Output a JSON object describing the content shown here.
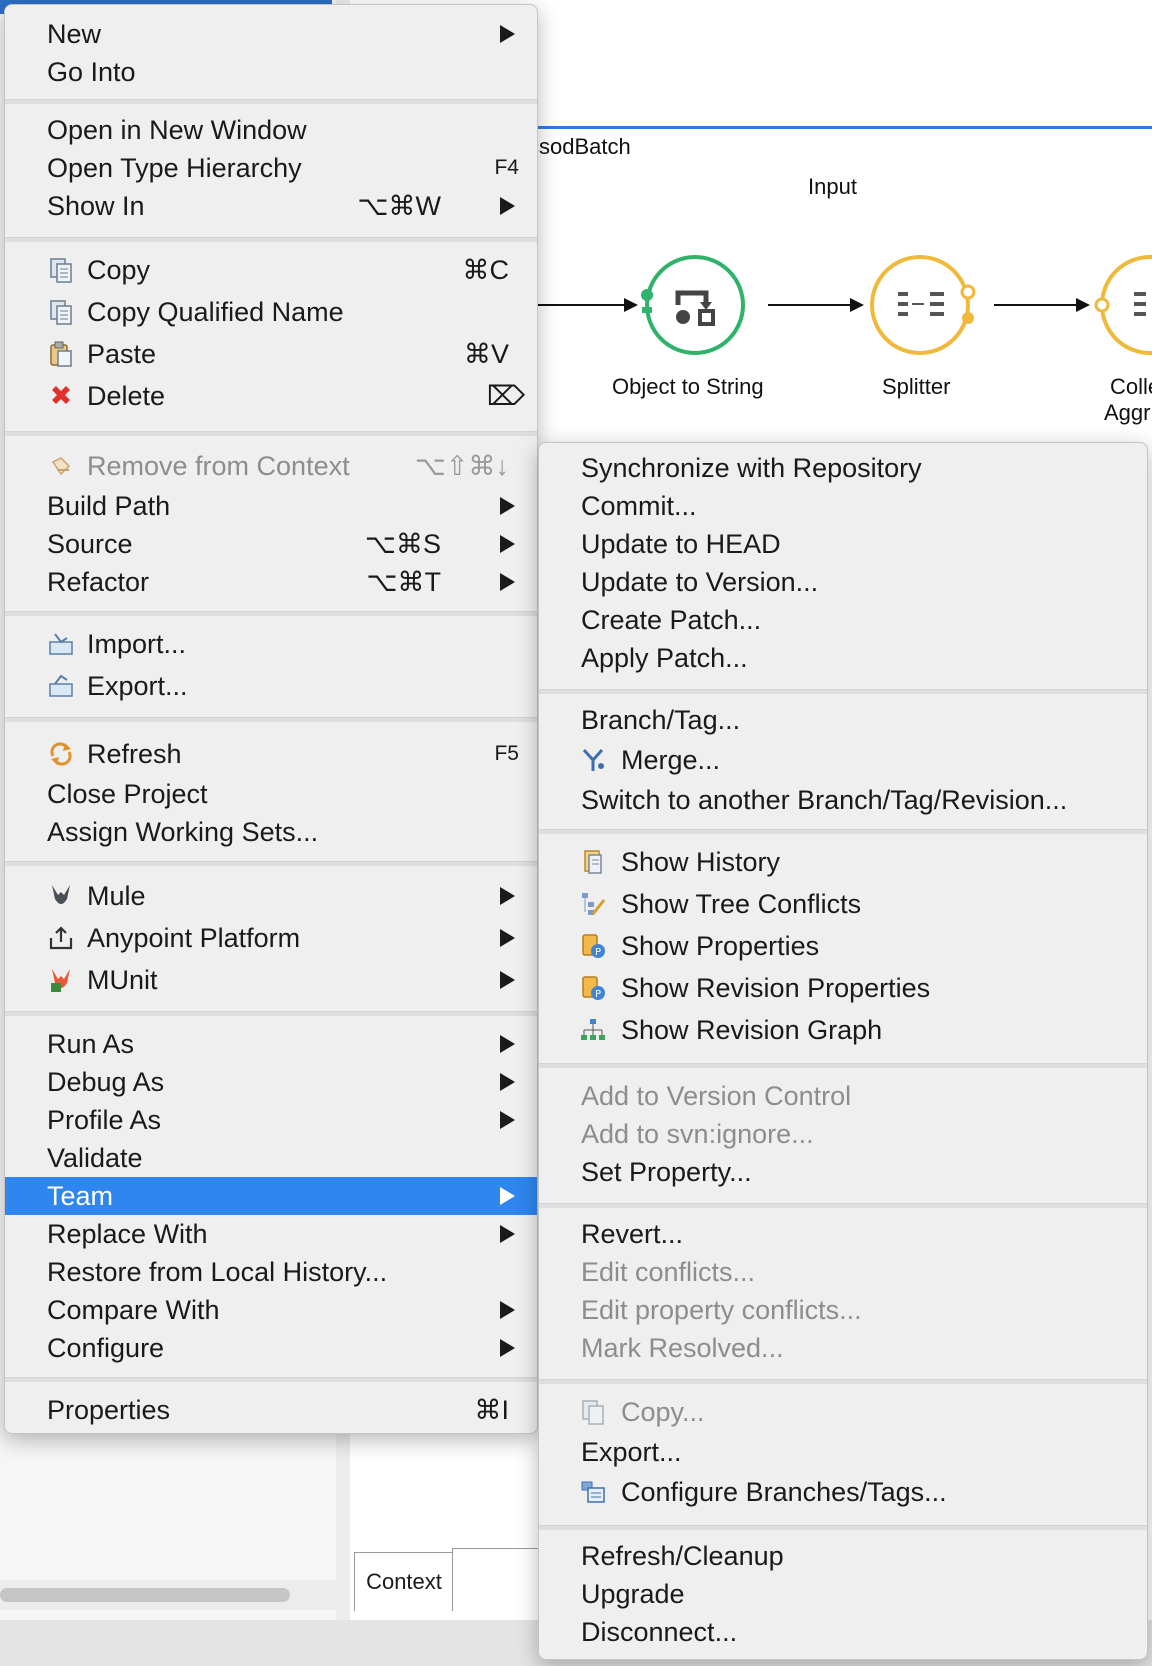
{
  "background": {
    "flow_title_fragment": "csodBatch",
    "input_label": "Input",
    "nodes": [
      "Object to String",
      "Splitter",
      "Colle",
      "Aggr"
    ],
    "tab_label": "Context"
  },
  "main_menu": {
    "new": "New",
    "go_into": "Go Into",
    "open_new_window": "Open in New Window",
    "open_type_hierarchy": "Open Type Hierarchy",
    "open_type_hierarchy_shortcut": "F4",
    "show_in": "Show In",
    "show_in_shortcut": "⌥⌘W",
    "copy": "Copy",
    "copy_shortcut": "⌘C",
    "copy_qualified": "Copy Qualified Name",
    "paste": "Paste",
    "paste_shortcut": "⌘V",
    "delete": "Delete",
    "delete_shortcut": "⌦",
    "remove_from_context": "Remove from Context",
    "remove_from_context_shortcut": "⌥⇧⌘↓",
    "build_path": "Build Path",
    "source": "Source",
    "source_shortcut": "⌥⌘S",
    "refactor": "Refactor",
    "refactor_shortcut": "⌥⌘T",
    "import": "Import...",
    "export": "Export...",
    "refresh": "Refresh",
    "refresh_shortcut": "F5",
    "close_project": "Close Project",
    "assign_working_sets": "Assign Working Sets...",
    "mule": "Mule",
    "anypoint": "Anypoint Platform",
    "munit": "MUnit",
    "run_as": "Run As",
    "debug_as": "Debug As",
    "profile_as": "Profile As",
    "validate": "Validate",
    "team": "Team",
    "replace_with": "Replace With",
    "restore_local_history": "Restore from Local History...",
    "compare_with": "Compare With",
    "configure": "Configure",
    "properties": "Properties",
    "properties_shortcut": "⌘I"
  },
  "team_menu": {
    "synchronize": "Synchronize with Repository",
    "commit": "Commit...",
    "update_head": "Update to HEAD",
    "update_version": "Update to Version...",
    "create_patch": "Create Patch...",
    "apply_patch": "Apply Patch...",
    "branch_tag": "Branch/Tag...",
    "merge": "Merge...",
    "switch_branch": "Switch to another Branch/Tag/Revision...",
    "show_history": "Show History",
    "show_tree_conflicts": "Show Tree Conflicts",
    "show_properties": "Show Properties",
    "show_revision_properties": "Show Revision Properties",
    "show_revision_graph": "Show Revision Graph",
    "add_version_control": "Add to Version Control",
    "add_svn_ignore": "Add to svn:ignore...",
    "set_property": "Set Property...",
    "revert": "Revert...",
    "edit_conflicts": "Edit conflicts...",
    "edit_property_conflicts": "Edit property conflicts...",
    "mark_resolved": "Mark Resolved...",
    "copy": "Copy...",
    "export": "Export...",
    "configure_branches": "Configure Branches/Tags...",
    "refresh_cleanup": "Refresh/Cleanup",
    "upgrade": "Upgrade",
    "disconnect": "Disconnect..."
  },
  "colors": {
    "selection": "#2f86ef",
    "flow_green": "#2fb36a",
    "flow_yellow": "#f0b93a",
    "disabled_text": "#8d8d8d"
  }
}
